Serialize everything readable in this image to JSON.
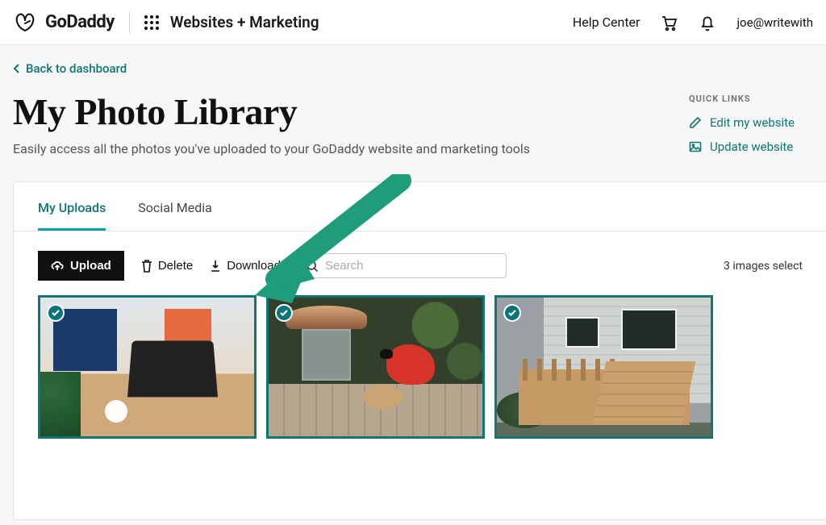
{
  "header": {
    "brand": "GoDaddy",
    "product": "Websites + Marketing",
    "help_center": "Help Center",
    "user_email": "joe@writewith"
  },
  "page": {
    "back_label": "Back to dashboard",
    "title": "My Photo Library",
    "subtitle": "Easily access all the photos you've uploaded to your GoDaddy website and marketing tools"
  },
  "quick_links": {
    "heading": "QUICK LINKS",
    "items": [
      {
        "label": "Edit my website"
      },
      {
        "label": "Update website"
      }
    ]
  },
  "tabs": {
    "uploads": "My Uploads",
    "social": "Social Media",
    "active": "uploads"
  },
  "toolbar": {
    "upload": "Upload",
    "delete": "Delete",
    "download": "Download",
    "search_placeholder": "Search",
    "selection_status": "3 images select"
  },
  "gallery": {
    "items": [
      {
        "alt": "desk-workspace",
        "selected": true
      },
      {
        "alt": "cardinal-bird-feeder",
        "selected": true
      },
      {
        "alt": "house-deck-stairs",
        "selected": true
      }
    ]
  },
  "colors": {
    "accent": "#0f7674",
    "accent_bright": "#00a4a6",
    "arrow": "#1f9d7a"
  }
}
